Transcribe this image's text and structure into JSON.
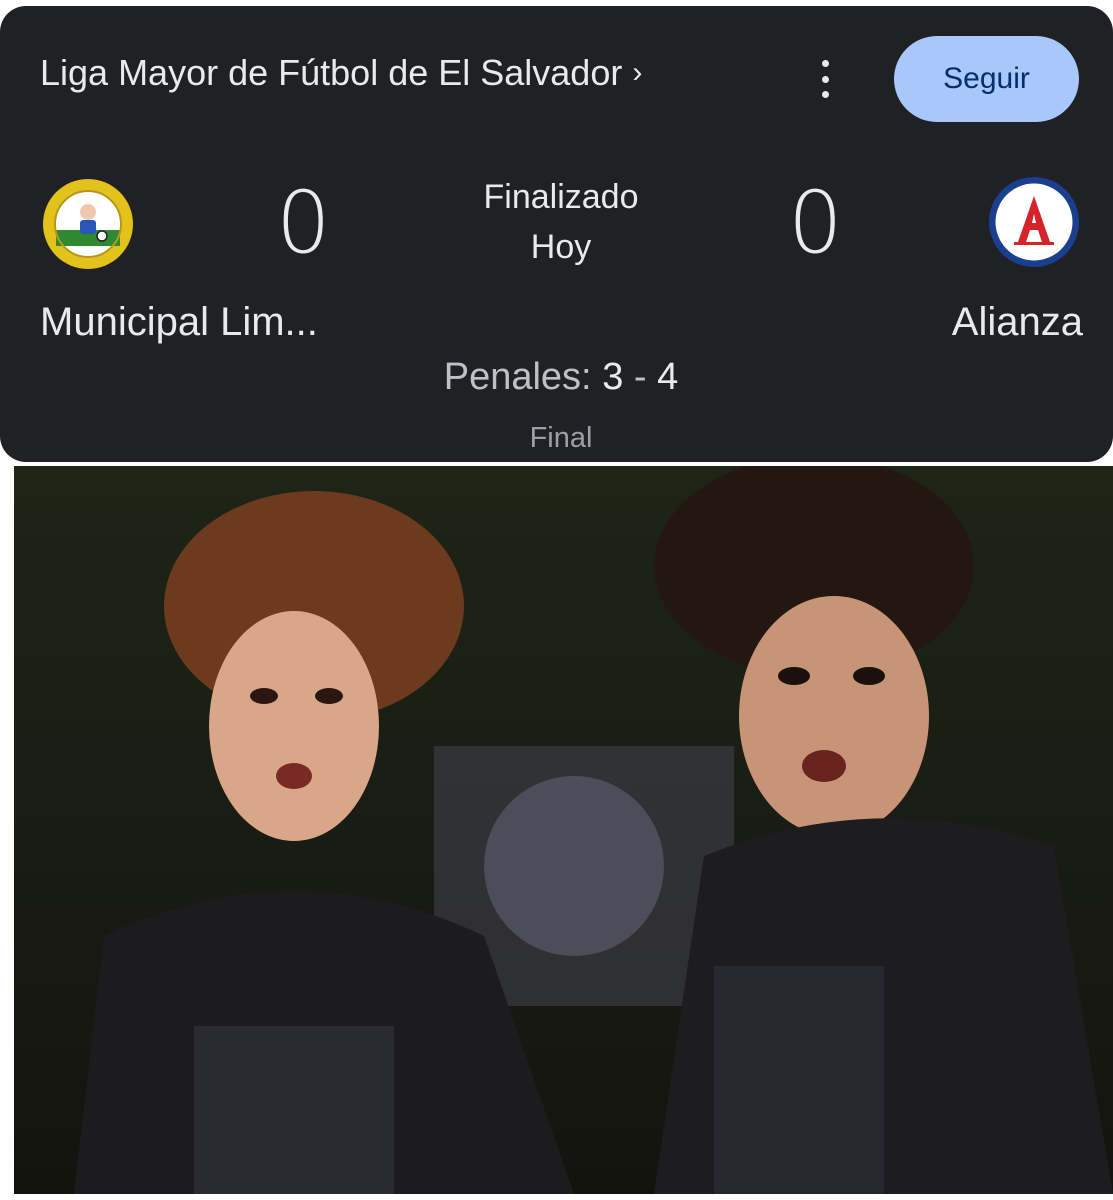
{
  "header": {
    "league": "Liga Mayor de Fútbol de El Salvador",
    "league_chevron": "›",
    "more_icon": "more-vert-icon",
    "follow_label": "Seguir"
  },
  "match": {
    "status": "Finalizado",
    "day": "Hoy",
    "home": {
      "name": "Municipal Lim...",
      "score": "0",
      "logo": "municipal-limeno-crest"
    },
    "away": {
      "name": "Alianza",
      "score": "0",
      "logo": "alianza-fc-crest"
    },
    "penalties_label": "Penales:",
    "penalties_home": "3",
    "penalties_sep": "-",
    "penalties_away": "4",
    "final_label": "Final"
  },
  "colors": {
    "card_bg": "#202124",
    "follow_bg": "#a8c7fa",
    "follow_text": "#062e6f",
    "text": "#e8eaed",
    "muted": "#9aa0a6"
  }
}
